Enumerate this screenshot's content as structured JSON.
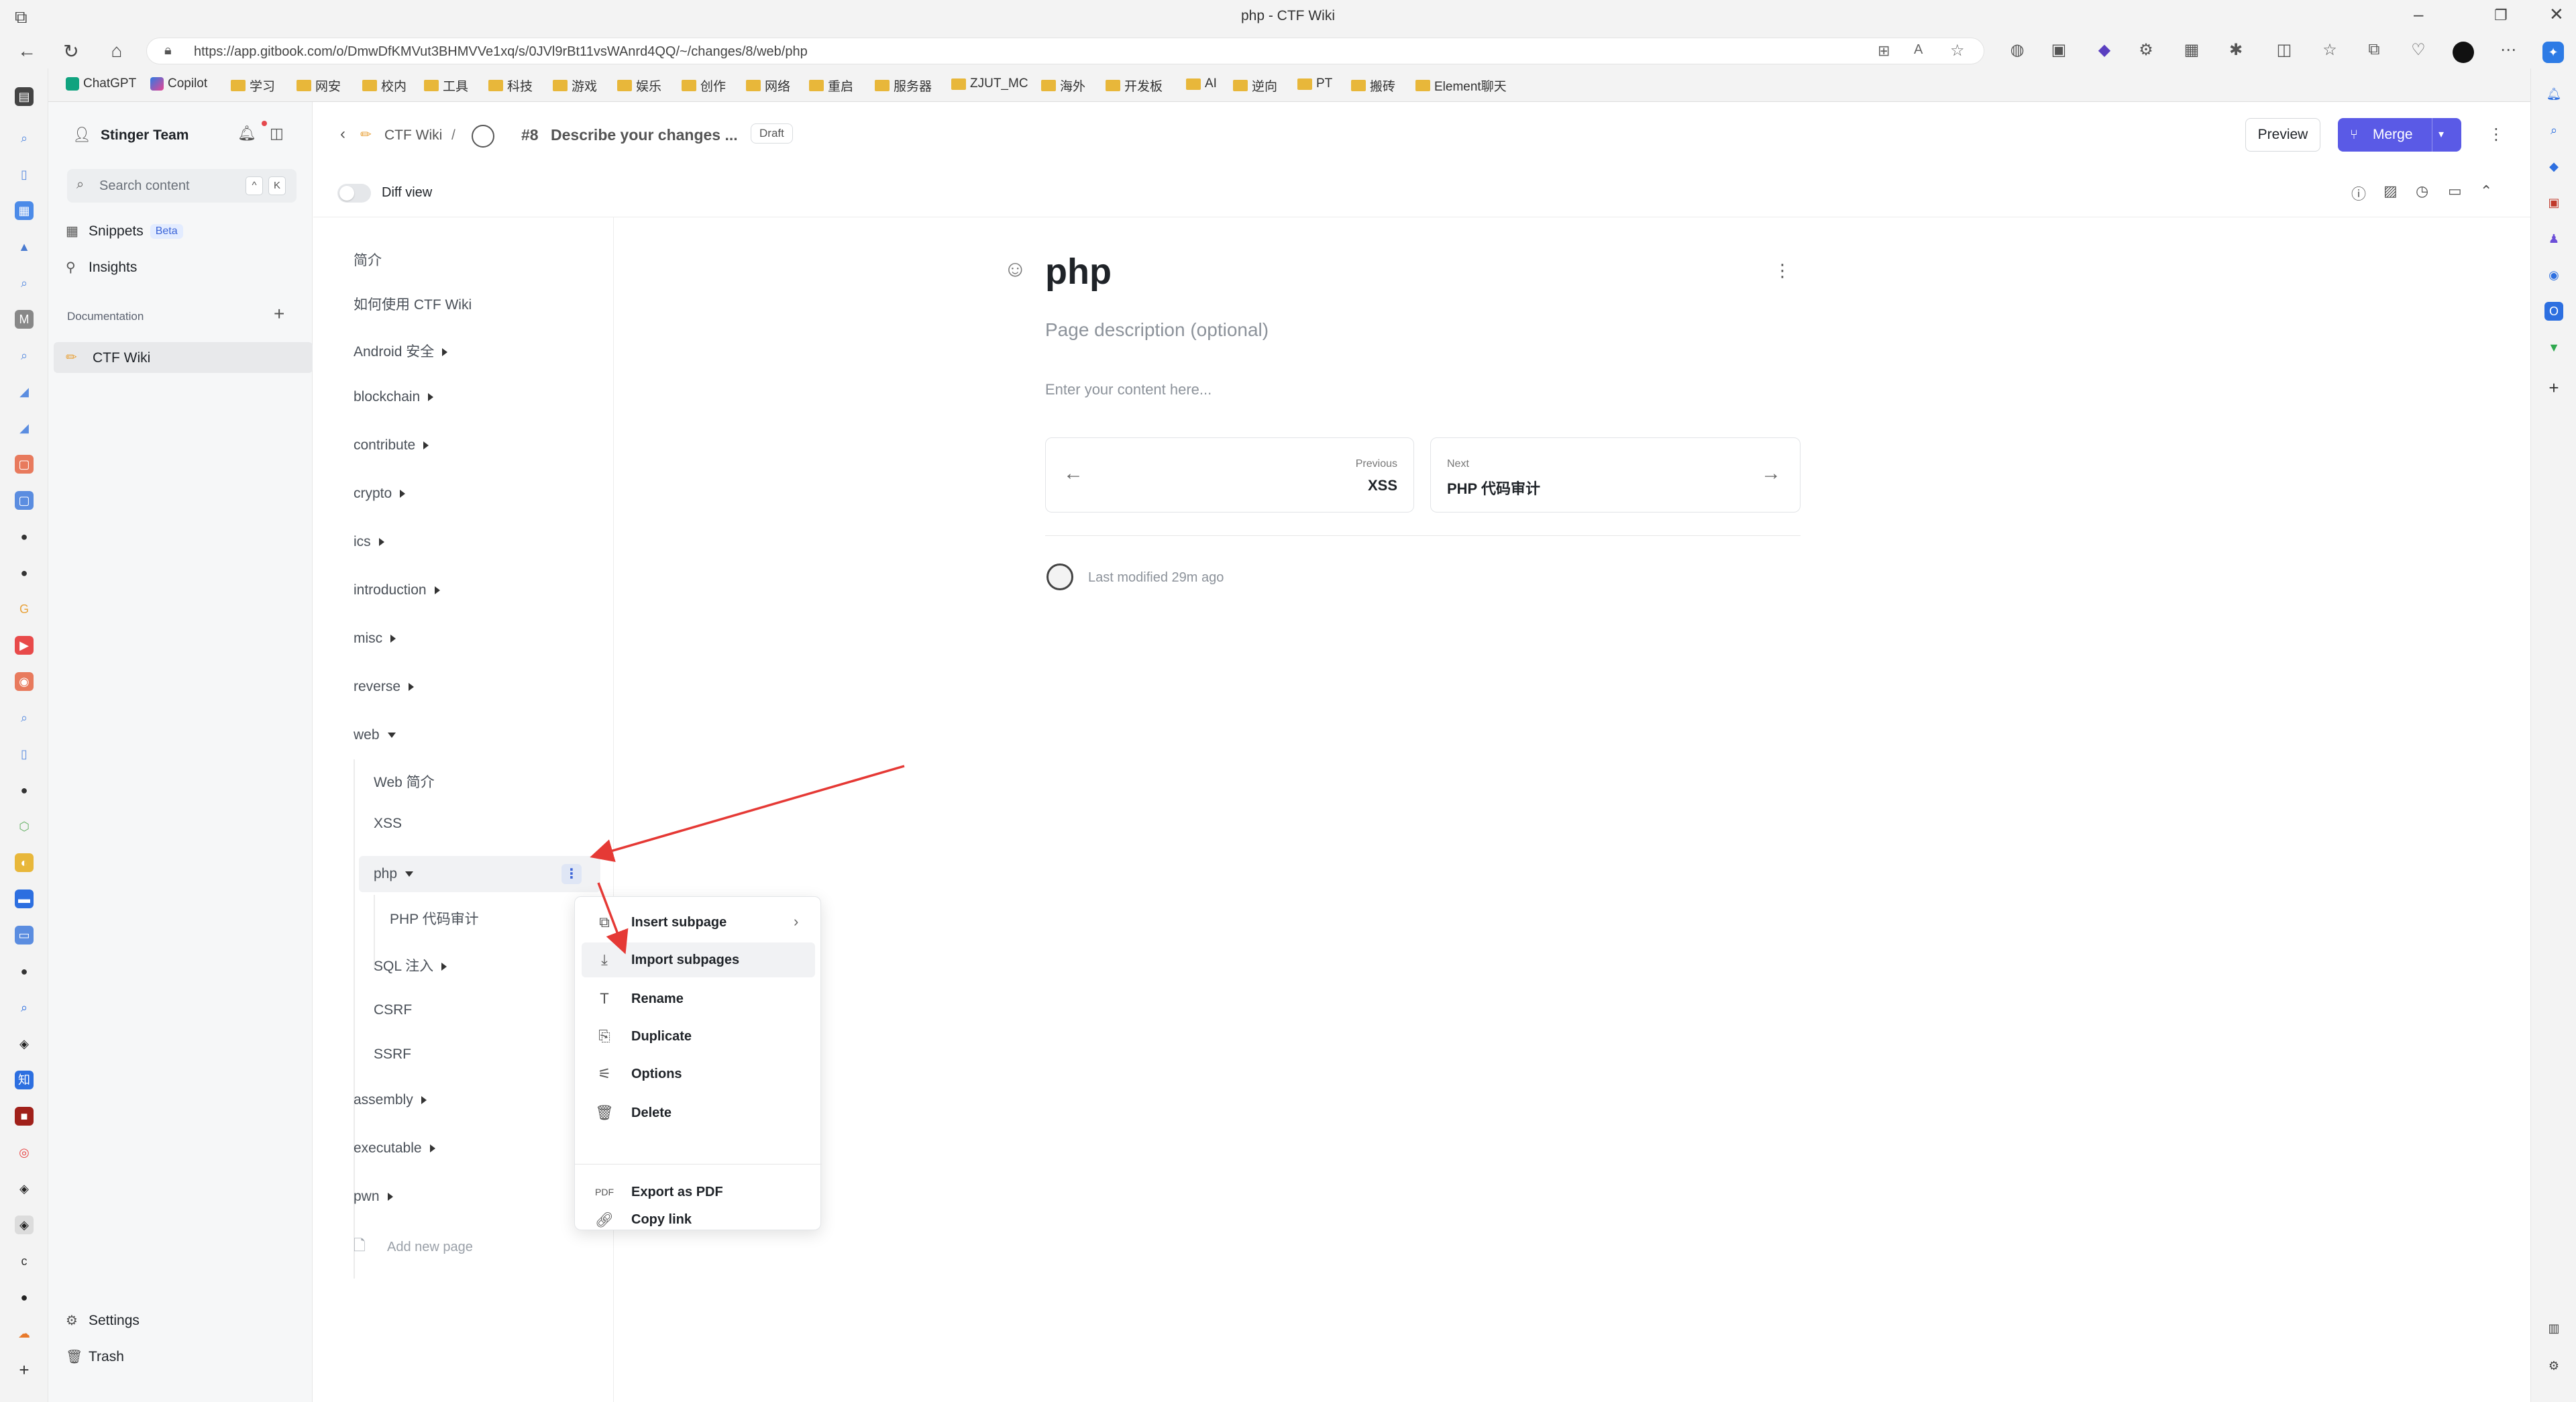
{
  "browser": {
    "window_title": "php - CTF Wiki",
    "url": "https://app.gitbook.com/o/DmwDfKMVut3BHMVVe1xq/s/0JVl9rBt11vsWAnrd4QQ/~/changes/8/web/php",
    "bookmarks": [
      "ChatGPT",
      "Copilot",
      "学习",
      "网安",
      "校内",
      "工具",
      "科技",
      "游戏",
      "娱乐",
      "创作",
      "网络",
      "重启",
      "服务器",
      "ZJUT_MC",
      "海外",
      "开发板",
      "AI",
      "逆向",
      "PT",
      "搬砖",
      "Element聊天"
    ]
  },
  "sidebar": {
    "team_name": "Stinger Team",
    "search_placeholder": "Search content",
    "shortcut_keys": [
      "^",
      "K"
    ],
    "snippets_label": "Snippets",
    "beta_badge": "Beta",
    "insights_label": "Insights",
    "section_label": "Documentation",
    "space_name": "CTF Wiki",
    "settings_label": "Settings",
    "trash_label": "Trash"
  },
  "toolbar": {
    "breadcrumb_space": "CTF Wiki",
    "breadcrumb_sep": "/",
    "change_number": "#8",
    "change_title": "Describe your changes ...",
    "draft_badge": "Draft",
    "preview_label": "Preview",
    "merge_label": "Merge",
    "diff_view_label": "Diff view"
  },
  "tree": {
    "items": [
      {
        "label": "简介",
        "expandable": false
      },
      {
        "label": "如何使用 CTF Wiki",
        "expandable": false
      },
      {
        "label": "Android 安全",
        "expandable": true
      },
      {
        "label": "blockchain",
        "expandable": true
      },
      {
        "label": "contribute",
        "expandable": true
      },
      {
        "label": "crypto",
        "expandable": true
      },
      {
        "label": "ics",
        "expandable": true
      },
      {
        "label": "introduction",
        "expandable": true
      },
      {
        "label": "misc",
        "expandable": true
      },
      {
        "label": "reverse",
        "expandable": true
      },
      {
        "label": "web",
        "expandable": true,
        "expanded": true
      }
    ],
    "web_children": [
      "Web 简介",
      "XSS",
      "php",
      "PHP 代码审计",
      "SQL 注入",
      "CSRF",
      "SSRF"
    ],
    "after_items": [
      "assembly",
      "executable",
      "pwn"
    ],
    "add_new_page": "Add new page"
  },
  "context_menu": {
    "items": [
      {
        "label": "Insert subpage",
        "icon": "insert-subpage-icon",
        "has_submenu": true
      },
      {
        "label": "Import subpages",
        "icon": "import-icon",
        "highlighted": true
      },
      {
        "label": "Rename",
        "icon": "rename-icon"
      },
      {
        "label": "Duplicate",
        "icon": "duplicate-icon"
      },
      {
        "label": "Options",
        "icon": "options-icon"
      },
      {
        "label": "Delete",
        "icon": "trash-icon"
      }
    ],
    "secondary": [
      {
        "label": "Export as PDF",
        "icon": "pdf-icon"
      },
      {
        "label": "Copy link",
        "icon": "link-icon"
      }
    ]
  },
  "page": {
    "title": "php",
    "description_placeholder": "Page description (optional)",
    "content_placeholder": "Enter your content here...",
    "previous_label": "Previous",
    "previous_title": "XSS",
    "next_label": "Next",
    "next_title": "PHP 代码审计",
    "last_modified": "Last modified 29m ago"
  },
  "colors": {
    "accent": "#5a5ae6",
    "annotation_arrow": "#e53935"
  }
}
